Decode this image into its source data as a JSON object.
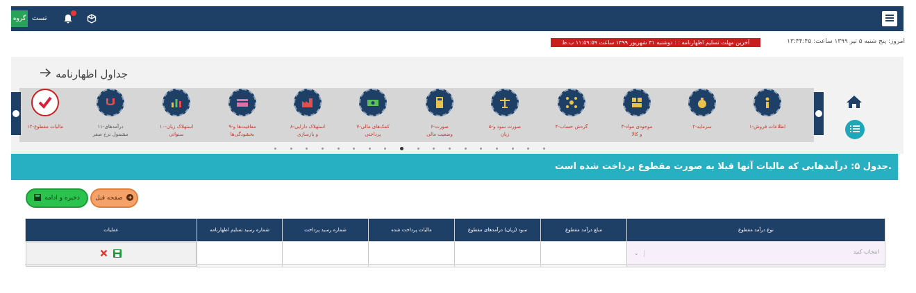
{
  "topbar": {
    "guest_button": "گروه",
    "guest_label": "تست",
    "icons": [
      "menu-icon",
      "bell-icon",
      "cube-icon"
    ]
  },
  "notice": "آخرین مهلت تسلیم اظهارنامه : : دوشنبه ۳۱ شهریور ۱۳۹۹ ساعت ۱۱:۵۹:۵۹ ب.ظ",
  "today": "امروز: پنج شنبه ۵ تیر ۱۳۹۹ ساعت: ۱۳:۴۴:۴۵",
  "page_title": "جداول اظهارنامه",
  "steps": [
    {
      "label_1": "۱-اطلاعات فروش",
      "label_2": "",
      "icon": "info-icon"
    },
    {
      "label_1": "۲-سرمایه",
      "label_2": "",
      "icon": "money-bag-icon"
    },
    {
      "label_1": "۳-موجودی مواد",
      "label_2": "و کالا",
      "icon": "warehouse-icon"
    },
    {
      "label_1": "۴-گردش حساب",
      "label_2": "",
      "icon": "network-icon"
    },
    {
      "label_1": "۵-صورت سود و",
      "label_2": "زیان",
      "icon": "scale-icon"
    },
    {
      "label_1": "۶-صورت",
      "label_2": "وضعیت مالی",
      "icon": "calculator-icon"
    },
    {
      "label_1": "۷-کمک‌های مالی",
      "label_2": "پرداختی",
      "icon": "cash-icon"
    },
    {
      "label_1": "۸-استهلاک دارایی",
      "label_2": "و بازسازی",
      "icon": "factory-icon"
    },
    {
      "label_1": "۹-معافیت‌ها و",
      "label_2": "بخشودگی‌ها",
      "icon": "card-icon"
    },
    {
      "label_1": "۱۰-استهلاک زیان",
      "label_2": "سنواتی",
      "icon": "bar-chart-icon"
    },
    {
      "label_1": "۱۱-درآمدهای",
      "label_2": "مشمول نرخ صفر",
      "icon": "magnet-icon"
    },
    {
      "label_1": "۱۲-مالیات مقطوع",
      "label_2": "",
      "icon": "check-icon"
    }
  ],
  "carousel_dots": 18,
  "carousel_active_dot": 8,
  "banner": "جدول ۵: درآمدهایی که مالیات آنها قبلا به صورت مقطوع پرداخت شده است.",
  "buttons": {
    "save_continue": "ذخیره و ادامه",
    "prev_page": "صفحه قبل"
  },
  "table": {
    "headers": [
      "نوع درآمد مقطوع",
      "مبلغ درآمد مقطوع",
      "سود (زیان) درآمدهای مقطوع",
      "مالیات پرداخت شده",
      "شماره رسید پرداخت",
      "شماره رسید تسلیم اظهارنامه",
      "عملیات"
    ],
    "select_placeholder": "انتخاب کنید"
  }
}
